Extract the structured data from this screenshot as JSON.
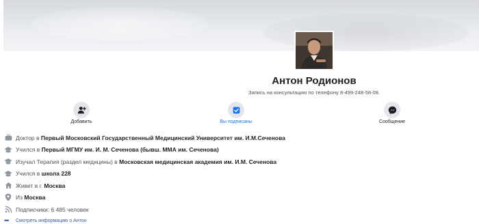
{
  "profile": {
    "name": "Антон Родионов",
    "bio": "Запись на консультацию по телефону 8-499-248-58-08."
  },
  "actions": {
    "add_friend": "Добавить",
    "following": "Вы подписаны",
    "message": "Сообщение"
  },
  "colors": {
    "accent": "#1877f2",
    "link": "#385898",
    "icon": "#65676b"
  },
  "info": [
    {
      "icon": "briefcase-icon",
      "prefix": "Доктор в ",
      "bold": "Первый Московский Государственный Медицинский Университет им. И.М.Сеченова"
    },
    {
      "icon": "graduation-cap-icon",
      "prefix": "Учился в ",
      "bold": "Первый МГМУ им. И. М. Сеченова (бывш. ММА им. Сеченова)"
    },
    {
      "icon": "graduation-cap-icon",
      "prefix": "Изучал Терапия (раздел медицины) в ",
      "bold": "Московская медицинская академия им. И.М. Сеченова"
    },
    {
      "icon": "graduation-cap-icon",
      "prefix": "Учился в ",
      "bold": "школа 228"
    },
    {
      "icon": "home-icon",
      "prefix": "Живет в г. ",
      "bold": "Москва"
    },
    {
      "icon": "location-pin-icon",
      "prefix": "Из ",
      "bold": "Москва"
    },
    {
      "icon": "rss-icon",
      "prefix": "Подписчики: 6 485 человек",
      "bold": ""
    }
  ],
  "more_link": "Смотреть информацию о Антон"
}
